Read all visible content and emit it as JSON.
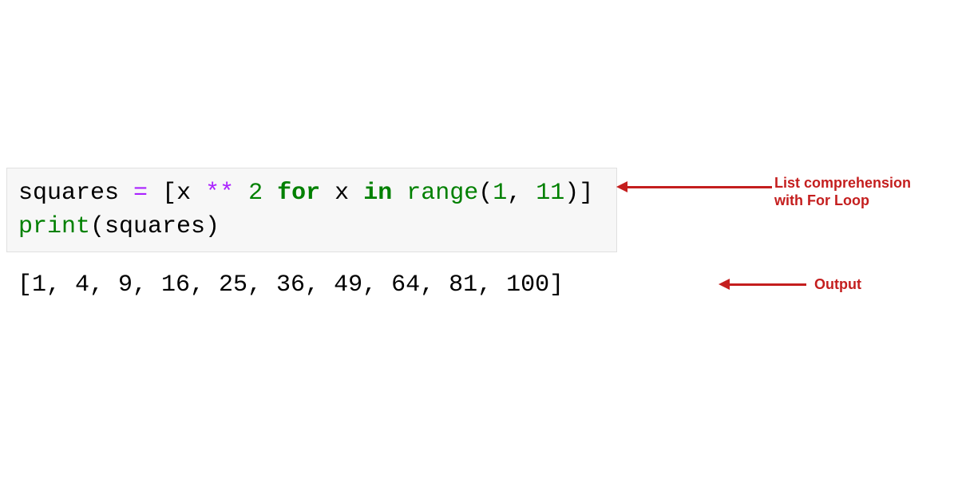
{
  "code": {
    "line1": {
      "t1": "squares ",
      "eq": "=",
      "sp1": " ",
      "lb": "[",
      "x1": "x ",
      "star": "**",
      "sp2": " ",
      "two": "2",
      "sp3": " ",
      "forkw": "for",
      "sp4": " x ",
      "inkw": "in",
      "sp5": " ",
      "rangefn": "range",
      "paren1": "(",
      "one": "1",
      "comma": ", ",
      "eleven": "11",
      "paren2": ")",
      "rb": "]"
    },
    "line2": {
      "printfn": "print",
      "rest": "(squares)"
    }
  },
  "output": "[1, 4, 9, 16, 25, 36, 49, 64, 81, 100]",
  "annotations": {
    "list_comp": "List comprehension with For Loop",
    "output": "Output"
  }
}
